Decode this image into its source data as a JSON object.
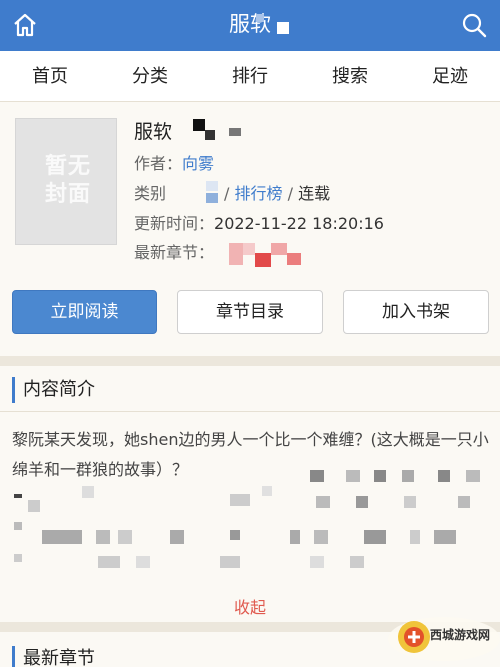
{
  "topbar": {
    "title": "服软"
  },
  "nav": [
    "首页",
    "分类",
    "排行",
    "搜索",
    "足迹"
  ],
  "book": {
    "title": "服软",
    "cover_text": "暂无封面",
    "author_label": "作者：",
    "author": "向雾",
    "category_label": "类别",
    "category_rank": "排行榜",
    "category_sep": "/",
    "status_sep": "/",
    "status": "连载",
    "update_label": "更新时间：",
    "update_time": "2022-11-22 18:20:16",
    "latest_label": "最新章节："
  },
  "buttons": {
    "read": "立即阅读",
    "toc": "章节目录",
    "shelf": "加入书架"
  },
  "intro": {
    "heading": "内容简介",
    "text": "黎阮某天发现，她shen边的男人一个比一个难缠？(这大概是一只小绵羊和一群狼的故事）？",
    "collapse": "收起"
  },
  "latest": {
    "heading": "最新章节"
  },
  "watermark": {
    "text": "西城游戏网"
  },
  "colors": {
    "brand": "#3f7ccc",
    "accent": "#e05a4f"
  }
}
